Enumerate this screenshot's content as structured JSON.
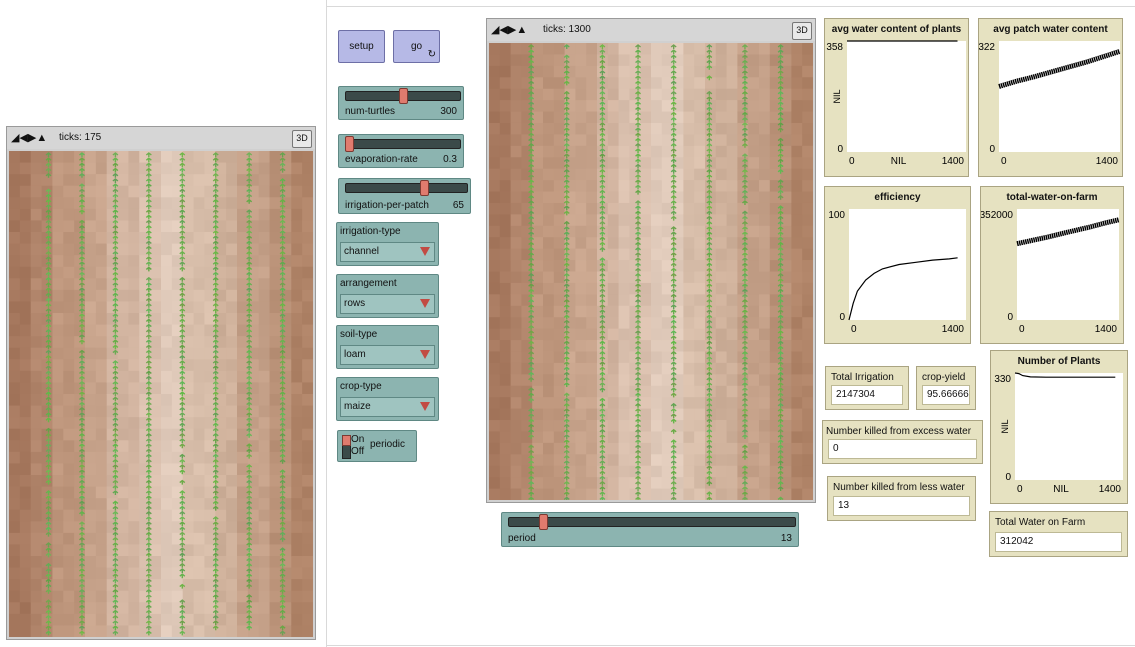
{
  "left_view": {
    "ticks": "ticks: 175",
    "btn_3d": "3D"
  },
  "main_view": {
    "ticks": "ticks: 1300",
    "btn_3d": "3D"
  },
  "buttons": {
    "setup": "setup",
    "go": "go"
  },
  "sliders": {
    "num_turtles": {
      "label": "num-turtles",
      "value": "300",
      "fraction": 0.48
    },
    "evaporation_rate": {
      "label": "evaporation-rate",
      "value": "0.3",
      "fraction": 0.02
    },
    "irrigation_per_patch": {
      "label": "irrigation-per-patch",
      "value": "65",
      "fraction": 0.65
    },
    "period": {
      "label": "period",
      "value": "13",
      "fraction": 0.12
    }
  },
  "choosers": {
    "irrigation_type": {
      "label": "irrigation-type",
      "value": "channel"
    },
    "arrangement": {
      "label": "arrangement",
      "value": "rows"
    },
    "soil_type": {
      "label": "soil-type",
      "value": "loam"
    },
    "crop_type": {
      "label": "crop-type",
      "value": "maize"
    }
  },
  "switch": {
    "on": "On",
    "off": "Off",
    "label": "periodic",
    "state": "on"
  },
  "monitors": {
    "total_irrigation": {
      "label": "Total Irrigation",
      "value": "2147304"
    },
    "crop_yield": {
      "label": "crop-yield",
      "value": "95.6666666"
    },
    "killed_excess": {
      "label": "Number killed from excess water",
      "value": "0"
    },
    "killed_less": {
      "label": "Number killed from less water",
      "value": "13"
    },
    "total_water": {
      "label": "Total Water on Farm",
      "value": "312042"
    }
  },
  "plots": {
    "avg_water_plants": {
      "title": "avg water content of plants",
      "ymax": "358",
      "ymin": "0",
      "xmin": "0",
      "xmax": "1400",
      "xlabel": "NIL",
      "ylabel": "NIL"
    },
    "avg_patch_water": {
      "title": "avg patch water content",
      "ymax": "322",
      "ymin": "0",
      "xmin": "0",
      "xmax": "1400"
    },
    "efficiency": {
      "title": "efficiency",
      "ymax": "100",
      "ymin": "0",
      "xmin": "0",
      "xmax": "1400"
    },
    "total_water_farm": {
      "title": "total-water-on-farm",
      "ymax": "352000",
      "ymin": "0",
      "xmin": "0",
      "xmax": "1400"
    },
    "num_plants": {
      "title": "Number of Plants",
      "ymax": "330",
      "ymin": "0",
      "xmin": "0",
      "xmax": "1400",
      "xlabel": "NIL",
      "ylabel": "NIL"
    }
  },
  "chart_data": [
    {
      "type": "line",
      "title": "avg water content of plants",
      "xlabel": "NIL",
      "ylabel": "NIL",
      "xlim": [
        0,
        1400
      ],
      "ylim": [
        0,
        358
      ],
      "series": [
        {
          "x": [
            0,
            1300
          ],
          "y": [
            358,
            358
          ]
        }
      ]
    },
    {
      "type": "line",
      "title": "avg patch water content",
      "xlim": [
        0,
        1400
      ],
      "ylim": [
        0,
        322
      ],
      "series": [
        {
          "x": [
            0,
            200,
            400,
            600,
            800,
            1000,
            1200,
            1400
          ],
          "y": [
            190,
            205,
            218,
            232,
            246,
            260,
            276,
            292
          ]
        }
      ]
    },
    {
      "type": "line",
      "title": "efficiency",
      "xlim": [
        0,
        1400
      ],
      "ylim": [
        0,
        100
      ],
      "series": [
        {
          "x": [
            0,
            50,
            100,
            200,
            300,
            400,
            600,
            800,
            1000,
            1200,
            1300
          ],
          "y": [
            0,
            15,
            26,
            36,
            42,
            46,
            50,
            52,
            54,
            55,
            56
          ]
        }
      ]
    },
    {
      "type": "line",
      "title": "total-water-on-farm",
      "xlim": [
        0,
        1400
      ],
      "ylim": [
        0,
        352000
      ],
      "series": [
        {
          "x": [
            0,
            200,
            400,
            600,
            800,
            1000,
            1200,
            1400
          ],
          "y": [
            242000,
            252000,
            262000,
            273000,
            284000,
            295000,
            307000,
            318000
          ]
        }
      ]
    },
    {
      "type": "line",
      "title": "Number of Plants",
      "xlabel": "NIL",
      "ylabel": "NIL",
      "xlim": [
        0,
        1400
      ],
      "ylim": [
        0,
        330
      ],
      "series": [
        {
          "x": [
            0,
            50,
            100,
            200,
            400,
            800,
            1300
          ],
          "y": [
            330,
            328,
            322,
            318,
            317,
            317,
            317
          ]
        }
      ]
    }
  ]
}
